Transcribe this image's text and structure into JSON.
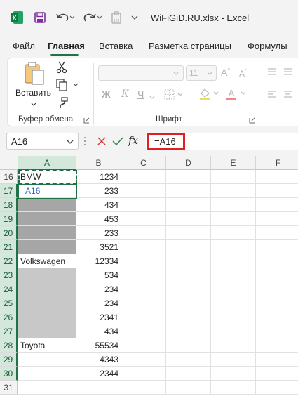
{
  "window": {
    "title": "WiFiGiD.RU.xlsx  -  Excel"
  },
  "tabs": [
    "Файл",
    "Главная",
    "Вставка",
    "Разметка страницы",
    "Формулы"
  ],
  "active_tab": "Главная",
  "ribbon": {
    "paste_label": "Вставить",
    "clipboard_group": "Буфер обмена",
    "font_group": "Шрифт",
    "font_size": "11",
    "bold": "Ж",
    "italic": "К",
    "underline": "Ч"
  },
  "formula_bar": {
    "name_box": "A16",
    "fx": "fx",
    "formula": "=A16"
  },
  "columns": [
    "A",
    "B",
    "C",
    "D",
    "E",
    "F"
  ],
  "rows": [
    {
      "num": "16",
      "a": "BMW",
      "b": "1234",
      "fill": ""
    },
    {
      "num": "17",
      "a_prefix": "=",
      "a_ref": "A16",
      "b": "233",
      "fill": ""
    },
    {
      "num": "18",
      "a": "",
      "b": "434",
      "fill": "#a6a6a6"
    },
    {
      "num": "19",
      "a": "",
      "b": "453",
      "fill": "#a6a6a6"
    },
    {
      "num": "20",
      "a": "",
      "b": "233",
      "fill": "#a6a6a6"
    },
    {
      "num": "21",
      "a": "",
      "b": "3521",
      "fill": "#a6a6a6"
    },
    {
      "num": "22",
      "a": "Volkswagen",
      "b": "12334",
      "fill": ""
    },
    {
      "num": "23",
      "a": "",
      "b": "534",
      "fill": "#c8c8c8"
    },
    {
      "num": "24",
      "a": "",
      "b": "234",
      "fill": "#c8c8c8"
    },
    {
      "num": "25",
      "a": "",
      "b": "234",
      "fill": "#c8c8c8"
    },
    {
      "num": "26",
      "a": "",
      "b": "2341",
      "fill": "#c8c8c8"
    },
    {
      "num": "27",
      "a": "",
      "b": "434",
      "fill": "#c8c8c8"
    },
    {
      "num": "28",
      "a": "Toyota",
      "b": "55534",
      "fill": ""
    },
    {
      "num": "29",
      "a": "",
      "b": "4343",
      "fill": ""
    },
    {
      "num": "30",
      "a": "",
      "b": "2344",
      "fill": ""
    },
    {
      "num": "31",
      "a": "",
      "b": "",
      "fill": ""
    }
  ],
  "colors": {
    "excel_green": "#217346",
    "highlight_red": "#e02020",
    "ref_blue": "#2f6dbf"
  }
}
